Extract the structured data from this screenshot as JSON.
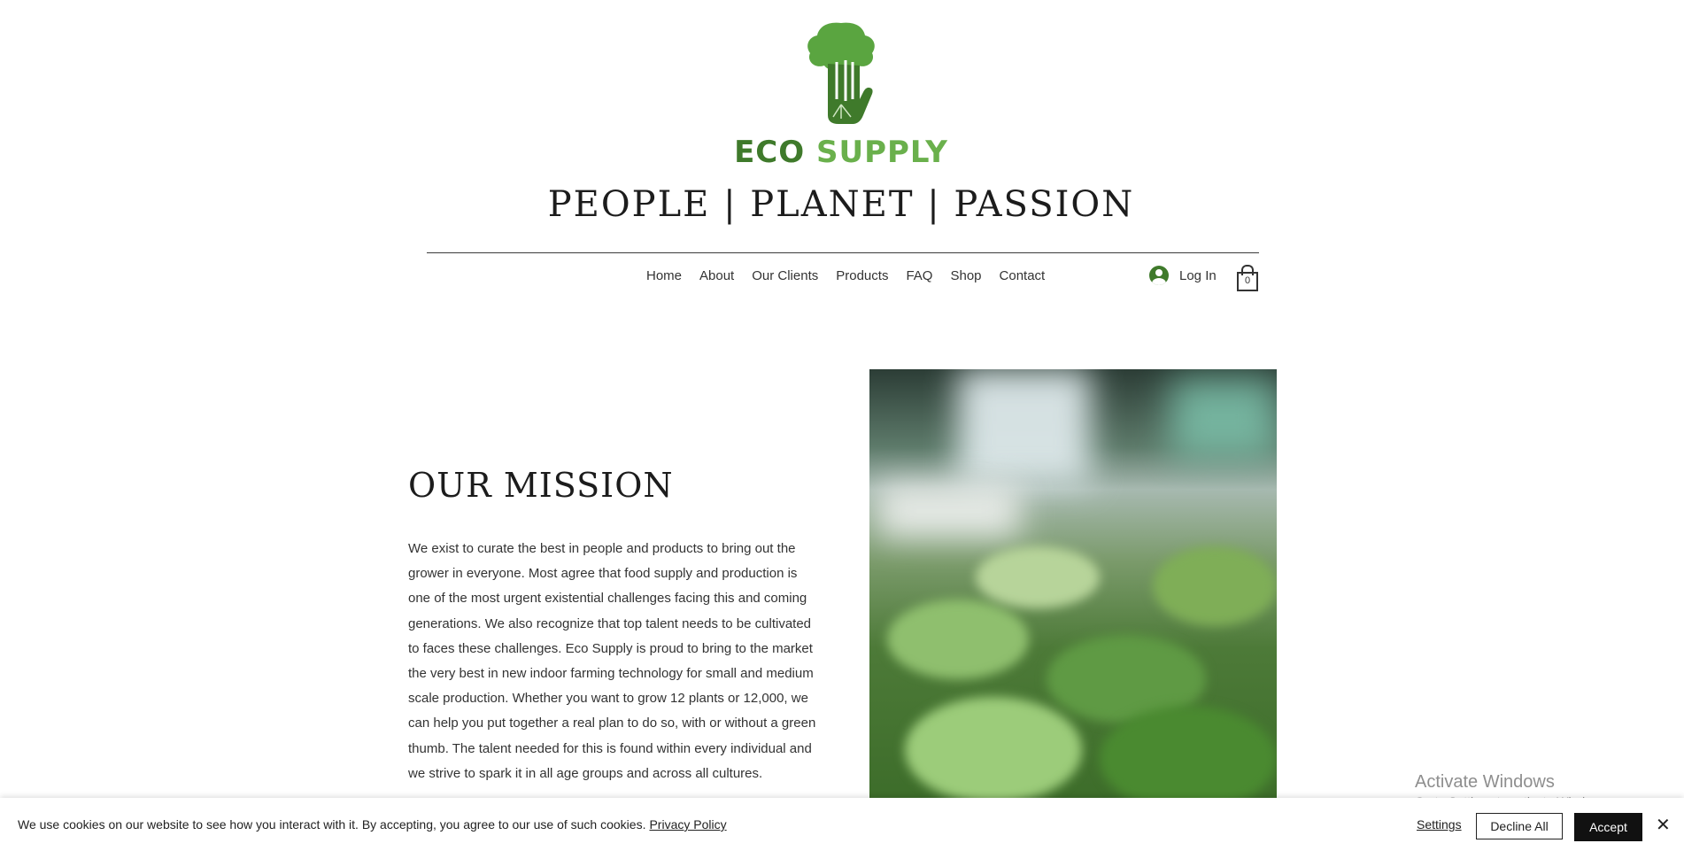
{
  "header": {
    "brand_eco": "ECO",
    "brand_supply": "SUPPLY",
    "tagline": "PEOPLE | PLANET | PASSION"
  },
  "nav": {
    "items": [
      "Home",
      "About",
      "Our Clients",
      "Products",
      "FAQ",
      "Shop",
      "Contact"
    ]
  },
  "account": {
    "login_label": "Log In",
    "cart_count": "0"
  },
  "mission": {
    "title": "OUR MISSION",
    "body": "We exist to curate the best in people and products to bring out the grower in everyone. Most agree that food supply and production is one of the most urgent existential challenges facing this and coming generations. We also recognize that top talent needs to be cultivated to faces these challenges. Eco Supply is proud to bring to the market the very best in new indoor farming technology for small and medium scale production. Whether you want to grow 12 plants or 12,000, we can help you put together a real plan to do so, with or without a green thumb. The talent needed for this is found within every individual and we strive to spark it in all age groups and across all cultures."
  },
  "windows_watermark": {
    "line1": "Activate Windows",
    "line2": "Go to Settings to activate Windows."
  },
  "cookie_banner": {
    "text": "We use cookies on our website to see how you interact with it. By accepting, you agree to our use of such cookies.",
    "privacy_link": "Privacy Policy",
    "settings_label": "Settings",
    "decline_label": "Decline All",
    "accept_label": "Accept",
    "close_glyph": "✕"
  },
  "colors": {
    "brand_dark_green": "#3f7a2b",
    "brand_light_green": "#6ab04c",
    "accept_button_bg": "#111111"
  }
}
